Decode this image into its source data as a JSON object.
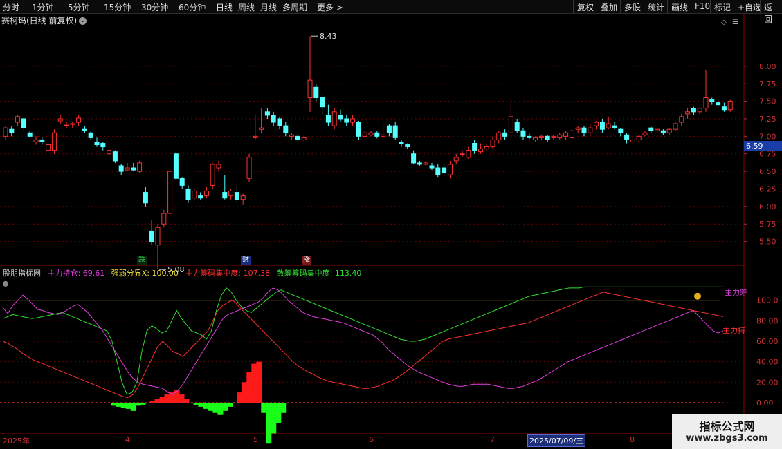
{
  "toolbar": {
    "periods": [
      "分时",
      "1分钟",
      "5分钟",
      "15分钟",
      "30分钟",
      "60分钟",
      "日线",
      "周线",
      "月线",
      "多周期",
      "更多 >"
    ],
    "active_period": "日线",
    "actions": [
      "复权",
      "叠加",
      "多股",
      "统计",
      "画线",
      "F10",
      "标记",
      "+自选",
      "返回"
    ]
  },
  "main": {
    "stock_title": "赛柯玛(日线 前复权)",
    "high_label": "8.43",
    "low_label": "5.08",
    "current_price": "6.59",
    "price_axis": [
      "8.00",
      "7.75",
      "7.50",
      "7.25",
      "7.00",
      "6.75",
      "6.50",
      "6.25",
      "6.00",
      "5.75",
      "5.50"
    ],
    "events": [
      {
        "text": "跌",
        "color": "#33c24a"
      },
      {
        "text": "财",
        "color": "#3a73ff"
      },
      {
        "text": "涨",
        "color": "#e03030"
      }
    ]
  },
  "indicator": {
    "name": "股朋指标网",
    "values": [
      {
        "label": "主力持仓: 69.61",
        "color": "#e040e0"
      },
      {
        "label": "强弱分界X: 100.00",
        "color": "#f0e040"
      },
      {
        "label": "主力筹码集中度: 107.38",
        "color": "#ff3030"
      },
      {
        "label": "散筹筹码集中度: 113.40",
        "color": "#30e030"
      }
    ],
    "axis": [
      "100.0",
      "80.00",
      "60.00",
      "40.00",
      "20.00",
      "0.00"
    ],
    "right_tags": [
      {
        "text": "主力筹",
        "color": "#e040e0"
      },
      {
        "text": "主力持",
        "color": "#ff3030"
      }
    ]
  },
  "dates": {
    "labels": [
      "2025年",
      "4",
      "5",
      "6",
      "7",
      "8"
    ],
    "highlight": "2025/07/09/三"
  },
  "watermark": {
    "line1": "指标公式网",
    "line2": "www.zbgs3.com"
  },
  "colors": {
    "up": "#ff3232",
    "down": "#54ffff",
    "grid": "#6b0000"
  },
  "chart_data": {
    "type": "candlestick",
    "candles": [
      [
        7.0,
        7.12,
        7.15,
        6.95
      ],
      [
        7.1,
        7.05,
        7.15,
        7.0
      ],
      [
        7.2,
        7.28,
        7.3,
        7.15
      ],
      [
        7.25,
        7.12,
        7.28,
        7.08
      ],
      [
        7.05,
        7.0,
        7.08,
        6.98
      ],
      [
        6.92,
        6.95,
        7.0,
        6.88
      ],
      [
        6.95,
        6.92,
        6.98,
        6.88
      ],
      [
        6.8,
        6.88,
        6.9,
        6.78
      ],
      [
        6.8,
        7.05,
        7.1,
        6.75
      ],
      [
        7.22,
        7.25,
        7.3,
        7.18
      ],
      [
        7.15,
        7.16,
        7.2,
        7.12
      ],
      [
        7.18,
        7.18,
        7.2,
        7.12
      ],
      [
        7.2,
        7.26,
        7.3,
        7.15
      ],
      [
        7.1,
        7.08,
        7.15,
        7.05
      ],
      [
        7.05,
        6.98,
        7.08,
        6.95
      ],
      [
        6.92,
        6.88,
        6.98,
        6.85
      ],
      [
        6.9,
        6.85,
        6.92,
        6.8
      ],
      [
        6.75,
        6.8,
        6.85,
        6.72
      ],
      [
        6.78,
        6.65,
        6.8,
        6.62
      ],
      [
        6.58,
        6.5,
        6.6,
        6.45
      ],
      [
        6.52,
        6.55,
        6.62,
        6.5
      ],
      [
        6.55,
        6.52,
        6.62,
        6.5
      ],
      [
        6.5,
        6.62,
        6.65,
        6.48
      ],
      [
        6.2,
        6.05,
        6.28,
        6.0
      ],
      [
        5.65,
        5.5,
        5.8,
        5.45
      ],
      [
        5.45,
        5.7,
        5.75,
        5.1
      ],
      [
        5.75,
        5.9,
        5.95,
        5.7
      ],
      [
        5.9,
        6.5,
        6.55,
        5.85
      ],
      [
        6.75,
        6.4,
        6.78,
        6.38
      ],
      [
        6.4,
        6.3,
        6.42,
        6.25
      ],
      [
        6.25,
        6.1,
        6.3,
        6.05
      ],
      [
        6.12,
        6.22,
        6.25,
        6.1
      ],
      [
        6.15,
        6.12,
        6.2,
        6.1
      ],
      [
        6.15,
        6.22,
        6.28,
        6.12
      ],
      [
        6.3,
        6.6,
        6.62,
        6.25
      ],
      [
        6.55,
        6.6,
        6.65,
        6.5
      ],
      [
        6.2,
        6.12,
        6.45,
        6.1
      ],
      [
        6.15,
        6.22,
        6.25,
        6.1
      ],
      [
        6.2,
        6.1,
        6.3,
        6.05
      ],
      [
        6.1,
        6.15,
        6.18,
        6.02
      ],
      [
        6.4,
        6.7,
        6.75,
        6.35
      ],
      [
        6.98,
        7.0,
        7.3,
        6.95
      ],
      [
        7.1,
        7.12,
        7.4,
        7.05
      ],
      [
        7.35,
        7.3,
        7.4,
        7.25
      ],
      [
        7.3,
        7.2,
        7.35,
        7.15
      ],
      [
        7.25,
        7.15,
        7.28,
        7.1
      ],
      [
        7.15,
        7.05,
        7.2,
        7.0
      ],
      [
        7.0,
        7.02,
        7.05,
        6.95
      ],
      [
        7.0,
        6.95,
        7.05,
        6.9
      ],
      [
        6.95,
        6.98,
        7.0,
        6.93
      ],
      [
        7.55,
        7.8,
        8.43,
        7.35
      ],
      [
        7.7,
        7.55,
        7.75,
        7.5
      ],
      [
        7.55,
        7.42,
        7.6,
        7.3
      ],
      [
        7.3,
        7.2,
        7.45,
        7.15
      ],
      [
        7.15,
        7.35,
        7.4,
        7.1
      ],
      [
        7.3,
        7.25,
        7.38,
        7.2
      ],
      [
        7.25,
        7.2,
        7.3,
        7.15
      ],
      [
        7.2,
        7.25,
        7.3,
        7.15
      ],
      [
        7.2,
        7.0,
        7.22,
        6.95
      ],
      [
        7.0,
        7.05,
        7.08,
        6.98
      ],
      [
        7.02,
        7.05,
        7.08,
        7.0
      ],
      [
        7.05,
        7.0,
        7.08,
        6.97
      ],
      [
        7.0,
        7.02,
        7.2,
        6.98
      ],
      [
        7.15,
        7.05,
        7.18,
        7.0
      ],
      [
        7.15,
        6.98,
        7.2,
        6.95
      ],
      [
        6.92,
        6.9,
        6.95,
        6.85
      ],
      [
        6.88,
        6.85,
        6.9,
        6.82
      ],
      [
        6.75,
        6.62,
        6.8,
        6.6
      ],
      [
        6.62,
        6.6,
        6.65,
        6.58
      ],
      [
        6.6,
        6.62,
        6.65,
        6.58
      ],
      [
        6.58,
        6.55,
        6.62,
        6.52
      ],
      [
        6.55,
        6.45,
        6.6,
        6.42
      ],
      [
        6.55,
        6.48,
        6.6,
        6.45
      ],
      [
        6.45,
        6.6,
        6.65,
        6.4
      ],
      [
        6.65,
        6.7,
        6.75,
        6.6
      ],
      [
        6.75,
        6.75,
        6.8,
        6.7
      ],
      [
        6.7,
        6.8,
        6.85,
        6.68
      ],
      [
        6.9,
        6.8,
        6.95,
        6.75
      ],
      [
        6.78,
        6.82,
        6.9,
        6.75
      ],
      [
        6.82,
        6.85,
        6.9,
        6.8
      ],
      [
        6.85,
        6.95,
        7.0,
        6.82
      ],
      [
        6.95,
        7.05,
        7.08,
        6.9
      ],
      [
        7.05,
        7.0,
        7.1,
        6.95
      ],
      [
        7.05,
        7.28,
        7.55,
        7.0
      ],
      [
        7.2,
        7.08,
        7.25,
        7.05
      ],
      [
        7.08,
        7.0,
        7.12,
        6.95
      ],
      [
        7.0,
        6.98,
        7.05,
        6.95
      ],
      [
        6.95,
        6.98,
        7.0,
        6.92
      ],
      [
        6.98,
        7.0,
        7.02,
        6.95
      ],
      [
        7.0,
        6.95,
        7.02,
        6.92
      ],
      [
        6.98,
        7.0,
        7.02,
        6.95
      ],
      [
        6.98,
        7.02,
        7.05,
        6.95
      ],
      [
        7.0,
        7.05,
        7.08,
        6.95
      ],
      [
        6.98,
        7.08,
        7.1,
        6.95
      ],
      [
        7.1,
        7.12,
        7.15,
        7.05
      ],
      [
        7.12,
        7.05,
        7.15,
        7.0
      ],
      [
        7.05,
        7.12,
        7.18,
        7.0
      ],
      [
        7.15,
        7.2,
        7.22,
        7.1
      ],
      [
        7.2,
        7.1,
        7.25,
        7.05
      ],
      [
        7.12,
        7.18,
        7.28,
        7.1
      ],
      [
        7.15,
        7.12,
        7.2,
        7.1
      ],
      [
        7.1,
        7.05,
        7.12,
        7.0
      ],
      [
        7.02,
        6.95,
        7.05,
        6.9
      ],
      [
        6.92,
        6.95,
        6.98,
        6.88
      ],
      [
        6.95,
        7.0,
        7.02,
        6.92
      ],
      [
        7.02,
        7.05,
        7.08,
        7.0
      ],
      [
        7.12,
        7.08,
        7.15,
        7.05
      ],
      [
        7.08,
        7.1,
        7.12,
        7.05
      ],
      [
        7.08,
        7.05,
        7.1,
        7.02
      ],
      [
        7.05,
        7.1,
        7.12,
        7.02
      ],
      [
        7.1,
        7.18,
        7.2,
        7.08
      ],
      [
        7.2,
        7.28,
        7.32,
        7.15
      ],
      [
        7.32,
        7.35,
        7.4,
        7.25
      ],
      [
        7.4,
        7.35,
        7.42,
        7.3
      ],
      [
        7.35,
        7.4,
        7.42,
        7.3
      ],
      [
        7.4,
        7.55,
        7.95,
        7.35
      ],
      [
        7.52,
        7.5,
        7.55,
        7.45
      ],
      [
        7.48,
        7.45,
        7.52,
        7.4
      ],
      [
        7.42,
        7.38,
        7.48,
        7.35
      ],
      [
        7.38,
        7.5,
        7.52,
        7.35
      ]
    ],
    "main_line": [
      93,
      87,
      95,
      100,
      105,
      101,
      96,
      91,
      90,
      88,
      87,
      86,
      88,
      91,
      94,
      96,
      92,
      88,
      82,
      76,
      70,
      62,
      54,
      46,
      38,
      30,
      24,
      20,
      18,
      17,
      16,
      15,
      14,
      10,
      8,
      12,
      18,
      26,
      34,
      42,
      50,
      58,
      66,
      74,
      82,
      86,
      88,
      90,
      92,
      94,
      96,
      98,
      102,
      108,
      112,
      110,
      106,
      100,
      96,
      92,
      88,
      86,
      84,
      83,
      82,
      81,
      80,
      79,
      78,
      76,
      74,
      72,
      70,
      68,
      66,
      62,
      58,
      52,
      48,
      44,
      40,
      36,
      33,
      30,
      28,
      26,
      24,
      22,
      20,
      18,
      17,
      16,
      16,
      17,
      18,
      18,
      18,
      18,
      17,
      16,
      15,
      14,
      14,
      15,
      16,
      18,
      20,
      22,
      25,
      28,
      31,
      34,
      37,
      40,
      42,
      44,
      46,
      48,
      50,
      52,
      54,
      56,
      58,
      60,
      62,
      64,
      66,
      68,
      70,
      72,
      74,
      76,
      78,
      80,
      82,
      84,
      86,
      88,
      90,
      85,
      80,
      75,
      70,
      68,
      70
    ],
    "main_line2": [
      60,
      58,
      55,
      52,
      48,
      45,
      42,
      40,
      38,
      36,
      34,
      32,
      30,
      28,
      26,
      24,
      22,
      20,
      18,
      16,
      14,
      12,
      10,
      8,
      6,
      5,
      8,
      15,
      25,
      35,
      45,
      55,
      60,
      55,
      50,
      48,
      45,
      50,
      55,
      60,
      65,
      70,
      80,
      90,
      95,
      98,
      100,
      95,
      90,
      85,
      80,
      75,
      70,
      65,
      60,
      55,
      50,
      45,
      40,
      36,
      33,
      30,
      28,
      25,
      23,
      21,
      20,
      19,
      18,
      17,
      16,
      15,
      14,
      14,
      15,
      16,
      18,
      20,
      22,
      25,
      28,
      32,
      36,
      40,
      44,
      48,
      52,
      56,
      60,
      62,
      63,
      64,
      65,
      66,
      67,
      68,
      69,
      70,
      71,
      72,
      73,
      74,
      75,
      76,
      77,
      78,
      80,
      82,
      84,
      86,
      88,
      90,
      92,
      94,
      96,
      98,
      100,
      102,
      104,
      106,
      108,
      107,
      106,
      105,
      104,
      103,
      102,
      101,
      100,
      99,
      98,
      97,
      96,
      95,
      94,
      93,
      92,
      91,
      90,
      89,
      88,
      87,
      86,
      85,
      84
    ],
    "scatter_line": [
      82,
      84,
      86,
      85,
      84,
      83,
      82,
      83,
      84,
      85,
      86,
      87,
      88,
      86,
      84,
      82,
      80,
      78,
      76,
      74,
      72,
      70,
      60,
      40,
      20,
      8,
      10,
      20,
      50,
      70,
      75,
      72,
      68,
      70,
      80,
      90,
      82,
      76,
      70,
      68,
      66,
      62,
      70,
      90,
      105,
      112,
      108,
      100,
      94,
      90,
      88,
      92,
      96,
      100,
      104,
      108,
      110,
      108,
      106,
      104,
      102,
      100,
      98,
      96,
      94,
      92,
      90,
      88,
      86,
      84,
      82,
      80,
      78,
      76,
      74,
      72,
      70,
      68,
      66,
      64,
      62,
      61,
      60,
      60,
      61,
      62,
      64,
      66,
      68,
      70,
      72,
      74,
      76,
      78,
      80,
      82,
      84,
      86,
      88,
      90,
      92,
      94,
      96,
      98,
      100,
      102,
      104,
      105,
      106,
      107,
      108,
      109,
      110,
      111,
      112,
      112,
      112,
      113,
      113,
      113,
      113,
      113,
      113,
      113,
      113,
      113,
      113,
      113,
      113,
      113,
      113,
      113,
      113,
      113,
      113,
      113,
      113,
      113,
      113,
      113,
      113,
      113,
      113,
      113,
      113,
      113
    ],
    "bars": [
      0,
      0,
      0,
      0,
      0,
      0,
      0,
      0,
      0,
      0,
      0,
      0,
      0,
      0,
      0,
      0,
      0,
      0,
      0,
      0,
      0,
      0,
      0,
      -3,
      -4,
      -5,
      -6,
      -8,
      -3,
      -2,
      0,
      2,
      4,
      6,
      8,
      10,
      12,
      8,
      4,
      0,
      -2,
      -4,
      -6,
      -8,
      -10,
      -12,
      -8,
      -4,
      0,
      10,
      20,
      30,
      38,
      40,
      -10,
      -40,
      -30,
      -20,
      -10,
      0,
      0,
      0,
      0,
      0,
      0,
      0,
      0,
      0,
      0,
      0,
      0,
      0,
      0,
      0,
      0,
      0,
      0,
      0,
      0,
      0,
      0,
      0,
      0,
      0,
      0,
      0,
      0,
      0,
      0,
      0,
      0,
      0,
      0,
      0,
      0,
      0,
      0,
      0,
      0,
      0,
      0,
      0,
      0,
      0,
      0,
      0,
      0,
      0,
      0,
      0,
      0,
      0,
      0,
      0,
      0,
      0,
      0,
      0,
      0,
      0,
      0,
      0,
      0,
      0,
      0,
      0,
      0,
      0,
      0,
      0,
      0,
      0,
      0,
      0,
      0,
      0,
      0,
      0,
      0,
      0,
      0,
      0,
      0,
      0,
      0,
      0,
      0,
      0,
      0,
      0
    ]
  }
}
